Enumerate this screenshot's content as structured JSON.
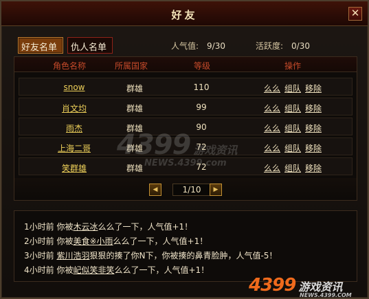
{
  "window": {
    "title": "好友",
    "close_label": "✕"
  },
  "tabs": [
    {
      "label": "好友名单",
      "active": true
    },
    {
      "label": "仇人名单",
      "active": false
    }
  ],
  "stats": {
    "popularity_label": "人气值:",
    "popularity_value": "9/30",
    "activity_label": "活跃度:",
    "activity_value": "0/30"
  },
  "table": {
    "headers": [
      "角色名称",
      "所属国家",
      "等级",
      "操作"
    ],
    "actions": [
      "么么",
      "组队",
      "移除"
    ],
    "rows": [
      {
        "name": "snow",
        "nation": "群雄",
        "level": "110"
      },
      {
        "name": "肖文均",
        "nation": "群雄",
        "level": "99"
      },
      {
        "name": "雨杰",
        "nation": "群雄",
        "level": "90"
      },
      {
        "name": "上海二哥",
        "nation": "群雄",
        "level": "72"
      },
      {
        "name": "笑群雄",
        "nation": "群雄",
        "level": "72"
      }
    ]
  },
  "pager": {
    "text": "1/10",
    "prev_icon": "triangle-left-icon",
    "next_icon": "triangle-right-icon"
  },
  "log": [
    {
      "a": "1小时前 你被",
      "link": "木云冰",
      "b": "么么了一下，人气值+1！"
    },
    {
      "a": "2小时前 你被",
      "link": "美食※小雨",
      "b": "么么了一下，人气值+1！"
    },
    {
      "a": "3小时前 ",
      "link": "紫川浩羽",
      "b": "狠狠的揍了你N下，你被揍的鼻青脸肿，人气值-5！"
    },
    {
      "a": "4小时前 你被",
      "link": "屺似笑非笑",
      "b": "么么了一下，人气值+1！"
    }
  ],
  "watermark": {
    "center_logo": "4399",
    "center_cn": "游戏资讯",
    "center_url": "NEWS.4399.com",
    "corner_logo": "4399",
    "corner_cn": "游戏资讯",
    "corner_url": "NEWS.4399.COM"
  },
  "colors": {
    "accent": "#c54a2a",
    "name_link": "#f0d25a",
    "frame": "#4c3d2c"
  }
}
